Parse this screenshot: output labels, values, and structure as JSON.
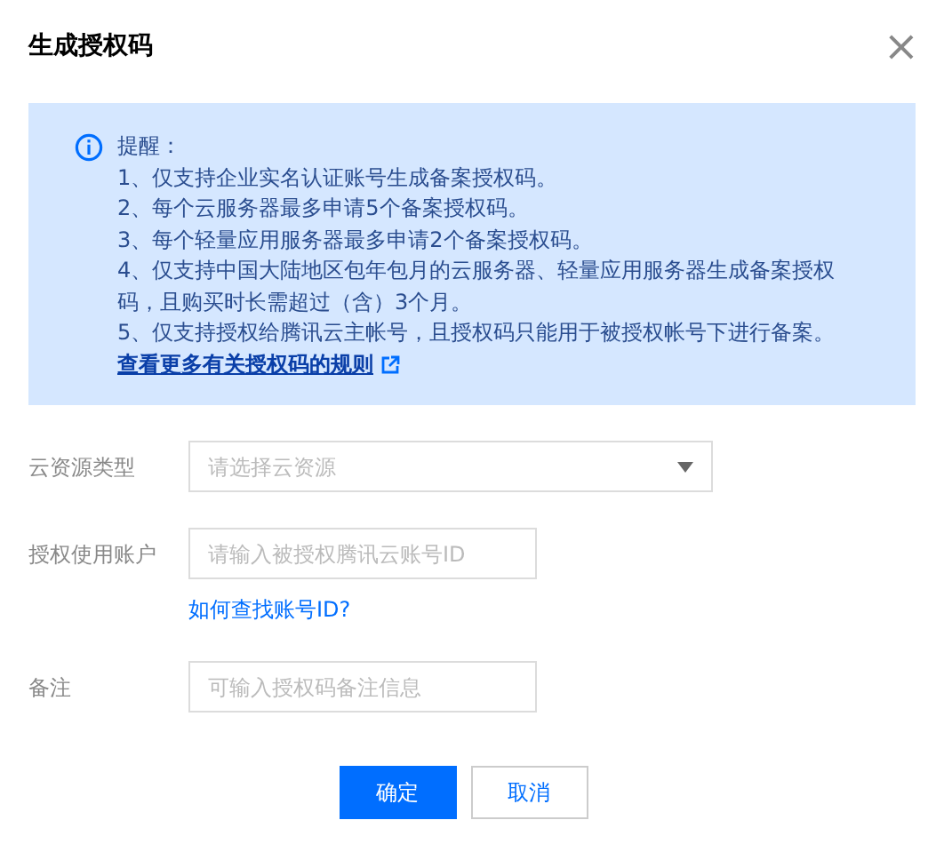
{
  "dialog": {
    "title": "生成授权码",
    "close": "×"
  },
  "notice": {
    "heading": "提醒：",
    "items": [
      "1、仅支持企业实名认证账号生成备案授权码。",
      "2、每个云服务器最多申请5个备案授权码。",
      "3、每个轻量应用服务器最多申请2个备案授权码。",
      "4、仅支持中国大陆地区包年包月的云服务器、轻量应用服务器生成备案授权码，且购买时长需超过（含）3个月。",
      "5、仅支持授权给腾讯云主帐号，且授权码只能用于被授权帐号下进行备案。"
    ],
    "link": "查看更多有关授权码的规则"
  },
  "fields": [
    {
      "kind": "select",
      "label": "云资源类型",
      "placeholder": "请选择云资源"
    },
    {
      "kind": "input",
      "label": "授权使用账户",
      "placeholder": "请输入被授权腾讯云账号ID",
      "help_link": "如何查找账号ID?"
    },
    {
      "kind": "input",
      "label": "备注",
      "placeholder": "可输入授权码备注信息"
    }
  ],
  "buttons": [
    {
      "kind": "primary",
      "label": "确定"
    },
    {
      "kind": "secondary",
      "label": "取消"
    }
  ]
}
